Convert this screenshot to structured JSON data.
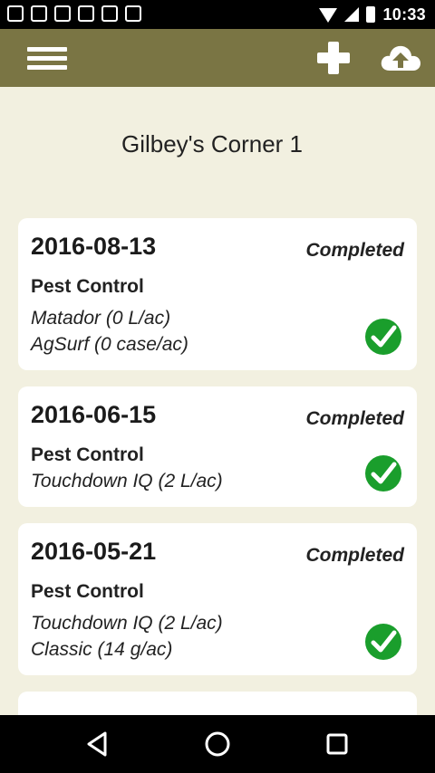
{
  "status_bar": {
    "time": "10:33"
  },
  "field": {
    "name": "Gilbey's Corner 1"
  },
  "records": [
    {
      "date": "2016-08-13",
      "status": "Completed",
      "type": "Pest Control",
      "products": [
        "Matador (0 L/ac)",
        "AgSurf (0 case/ac)"
      ]
    },
    {
      "date": "2016-06-15",
      "status": "Completed",
      "type": "Pest Control",
      "products": [
        "Touchdown IQ (2 L/ac)"
      ]
    },
    {
      "date": "2016-05-21",
      "status": "Completed",
      "type": "Pest Control",
      "products": [
        "Touchdown IQ (2 L/ac)",
        "Classic (14 g/ac)"
      ]
    }
  ],
  "colors": {
    "app_bar": "#7a7544",
    "background": "#f2f0e0",
    "check": "#1a9e2c"
  }
}
